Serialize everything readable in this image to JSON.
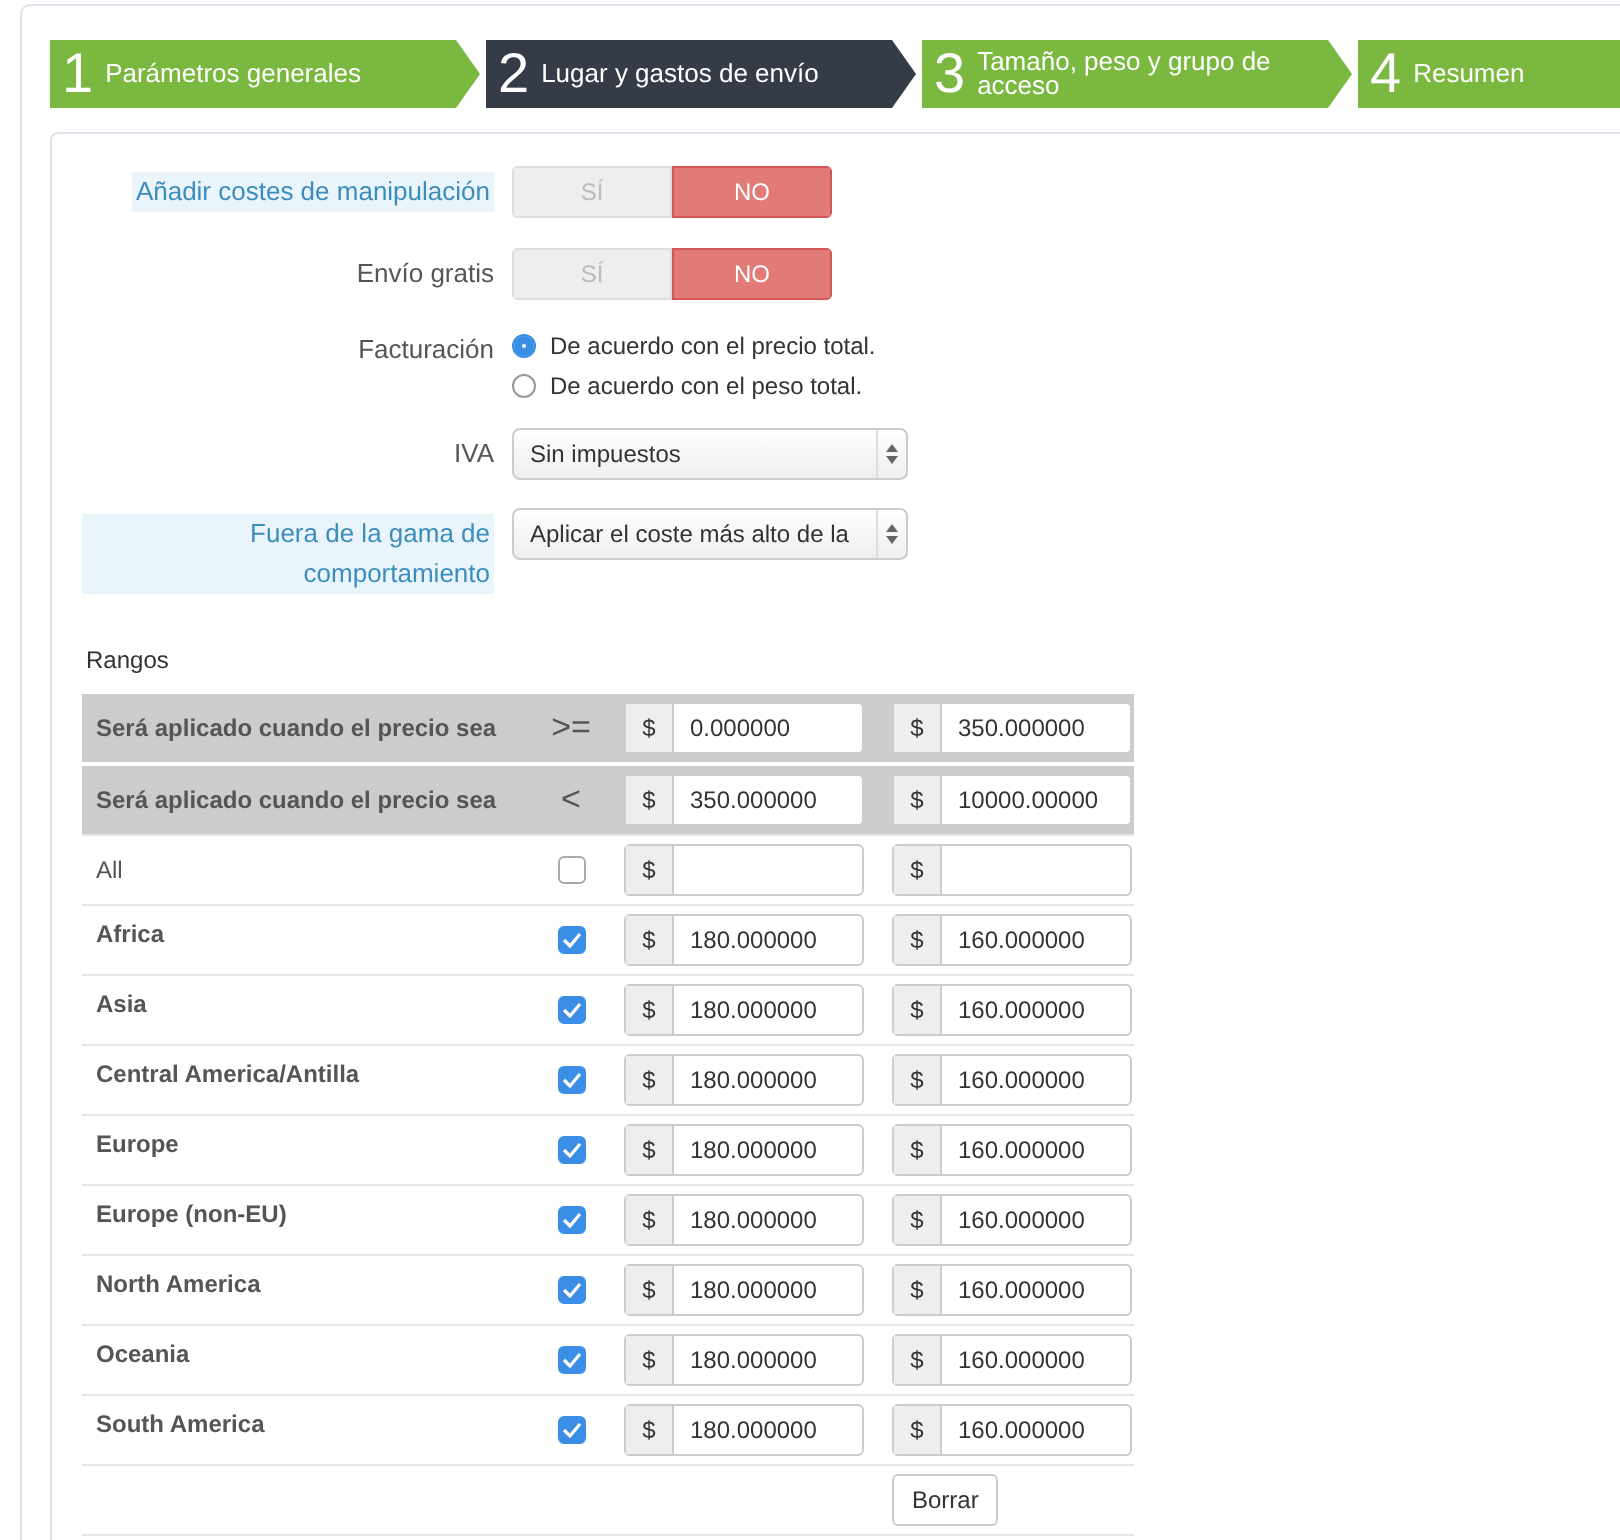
{
  "steps": [
    {
      "number": "1",
      "label": "Parámetros generales",
      "selected": false
    },
    {
      "number": "2",
      "label": "Lugar y gastos de envío",
      "selected": true
    },
    {
      "number": "3",
      "label": "Tamaño, peso y grupo de acceso",
      "selected": false
    },
    {
      "number": "4",
      "label": "Resumen",
      "selected": false
    }
  ],
  "form_rows": [
    {
      "kind": "toggle",
      "label": "Añadir costes de manipulación",
      "help": true,
      "options": [
        {
          "label": "SÍ",
          "selected": false
        },
        {
          "label": "NO",
          "selected": true
        }
      ]
    },
    {
      "kind": "toggle",
      "label": "Envío gratis",
      "help": false,
      "options": [
        {
          "label": "SÍ",
          "selected": false
        },
        {
          "label": "NO",
          "selected": true
        }
      ]
    },
    {
      "kind": "radio",
      "label": "Facturación",
      "help": false,
      "options": [
        {
          "label": "De acuerdo con el precio total.",
          "selected": true
        },
        {
          "label": "De acuerdo con el peso total.",
          "selected": false
        }
      ]
    },
    {
      "kind": "select",
      "label": "IVA",
      "help": false,
      "value": "Sin impuestos"
    },
    {
      "kind": "select",
      "label": "Fuera de la gama de comportamiento",
      "help": true,
      "value": "Aplicar el coste más alto de la"
    }
  ],
  "ranges": {
    "title": "Rangos",
    "header_rows": [
      {
        "label": "Será aplicado cuando el precio sea",
        "operator": ">=",
        "currency": "$",
        "from": "0.000000",
        "to": "350.000000"
      },
      {
        "label": "Será aplicado cuando el precio sea",
        "operator": "<",
        "currency": "$",
        "from": "350.000000",
        "to": "10000.00000"
      }
    ],
    "zones": [
      {
        "kind": "all",
        "name": "All",
        "checked": false
      },
      {
        "kind": "zone",
        "name": "Africa",
        "checked": true,
        "from": "180.000000",
        "to": "160.000000"
      },
      {
        "kind": "zone",
        "name": "Asia",
        "checked": true,
        "from": "180.000000",
        "to": "160.000000"
      },
      {
        "kind": "zone",
        "name": "Central America/Antilla",
        "checked": true,
        "from": "180.000000",
        "to": "160.000000"
      },
      {
        "kind": "zone",
        "name": "Europe",
        "checked": true,
        "from": "180.000000",
        "to": "160.000000"
      },
      {
        "kind": "zone",
        "name": "Europe (non-EU)",
        "checked": true,
        "from": "180.000000",
        "to": "160.000000"
      },
      {
        "kind": "zone",
        "name": "North America",
        "checked": true,
        "from": "180.000000",
        "to": "160.000000"
      },
      {
        "kind": "zone",
        "name": "Oceania",
        "checked": true,
        "from": "180.000000",
        "to": "160.000000"
      },
      {
        "kind": "zone",
        "name": "South America",
        "checked": true,
        "from": "180.000000",
        "to": "160.000000"
      }
    ],
    "currency": "$",
    "delete_button": "Borrar"
  }
}
